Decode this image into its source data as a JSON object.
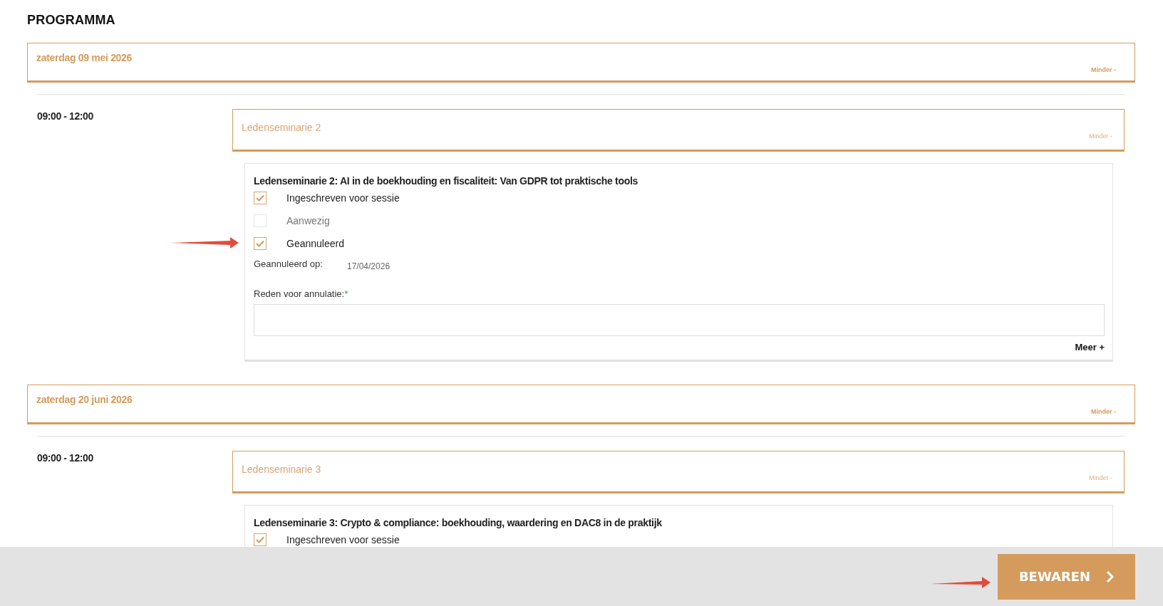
{
  "heading": "PROGRAMMA",
  "days": [
    {
      "date": "zaterdag 09 mei 2026",
      "toggle": "Minder -",
      "slots": [
        {
          "time": "09:00 - 12:00",
          "session": {
            "name": "Ledenseminarie 2",
            "toggle": "Minder -",
            "detail": {
              "title": "Ledenseminarie 2: AI in de boekhouding en fiscaliteit: Van GDPR tot praktische tools",
              "options": [
                {
                  "label": "Ingeschreven voor sessie",
                  "checked": true,
                  "disabled": false,
                  "arrow": false
                },
                {
                  "label": "Aanwezig",
                  "checked": false,
                  "disabled": true,
                  "arrow": false
                },
                {
                  "label": "Geannuleerd",
                  "checked": true,
                  "disabled": false,
                  "arrow": true
                }
              ],
              "cancelled_on": {
                "label": "Geannuleerd op:",
                "value": "17/04/2026"
              },
              "reason": {
                "label": "Reden voor annulatie:",
                "required_mark": "*"
              },
              "more": "Meer +"
            }
          }
        }
      ]
    },
    {
      "date": "zaterdag 20 juni 2026",
      "toggle": "Minder -",
      "slots": [
        {
          "time": "09:00 - 12:00",
          "session": {
            "name": "Ledenseminarie 3",
            "toggle": "Minder -",
            "detail": {
              "title": "Ledenseminarie 3: Crypto & compliance: boekhouding, waardering en DAC8 in de praktijk",
              "options": [
                {
                  "label": "Ingeschreven voor sessie",
                  "checked": true
                }
              ]
            }
          }
        }
      ]
    }
  ],
  "footer": {
    "button": "BEWAREN",
    "arrow": true
  }
}
